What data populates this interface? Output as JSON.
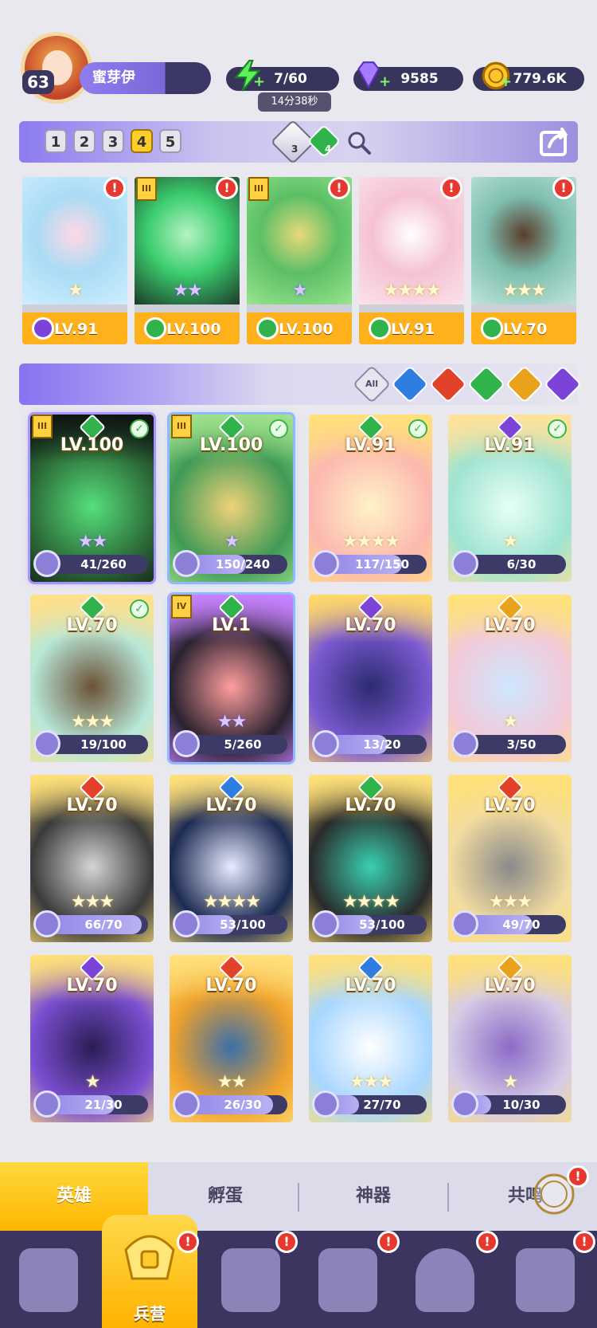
{
  "player": {
    "level": "63",
    "name": "蜜芽伊"
  },
  "resources": {
    "energy": "7/60",
    "energy_timer": "14分38秒",
    "gems": "9585",
    "gold": "779.6K"
  },
  "team_tabs": [
    "1",
    "2",
    "3",
    "4",
    "5"
  ],
  "active_team_tab": "4",
  "team_gems": {
    "purple_count": "3",
    "green_count": "4"
  },
  "team": [
    {
      "level": "LV.91",
      "element": "dark",
      "stars": "★",
      "star_color": "gold",
      "rank": "",
      "art": [
        "#cfeeff",
        "#a9dcf5",
        "#ffd8e6"
      ]
    },
    {
      "level": "LV.100",
      "element": "grass",
      "stars": "★★",
      "star_color": "purple",
      "rank": "III",
      "art": [
        "#1c3b2a",
        "#3cce6e",
        "#b6f2c5"
      ]
    },
    {
      "level": "LV.100",
      "element": "grass",
      "stars": "★",
      "star_color": "purple",
      "rank": "III",
      "art": [
        "#98e58d",
        "#5bbf66",
        "#e8d97a"
      ]
    },
    {
      "level": "LV.91",
      "element": "grass",
      "stars": "★★★★",
      "star_color": "gold",
      "rank": "",
      "art": [
        "#fbe2ea",
        "#f5c2d3",
        "#ffffff"
      ]
    },
    {
      "level": "LV.70",
      "element": "grass",
      "stars": "★★★",
      "star_color": "gold",
      "rank": "",
      "art": [
        "#bfe4d8",
        "#7fbfb0",
        "#5a3d2c"
      ]
    }
  ],
  "filters": [
    "All",
    "water",
    "fire",
    "grass",
    "light",
    "dark"
  ],
  "filter_all_label": "All",
  "heroes": [
    {
      "level": "LV.100",
      "element": "grass",
      "shards": "41/260",
      "fill": 0.16,
      "stars": "★★",
      "star_color": "purple",
      "checked": true,
      "rank": "III",
      "frame": "purple",
      "art": [
        "#101512",
        "#2d6e3a",
        "#56e07a"
      ]
    },
    {
      "level": "LV.100",
      "element": "grass",
      "shards": "150/240",
      "fill": 0.63,
      "stars": "★",
      "star_color": "purple",
      "checked": true,
      "rank": "III",
      "frame": "blue",
      "art": [
        "#9ee08c",
        "#3f9a55",
        "#f0d27a"
      ]
    },
    {
      "level": "LV.91",
      "element": "grass",
      "shards": "117/150",
      "fill": 0.78,
      "stars": "★★★★",
      "star_color": "gold",
      "checked": true,
      "rank": "",
      "frame": "",
      "art": [
        "#ffe07a",
        "#fcb8b0",
        "#fff3c6"
      ]
    },
    {
      "level": "LV.91",
      "element": "dark",
      "shards": "6/30",
      "fill": 0.2,
      "stars": "★",
      "star_color": "gold",
      "checked": true,
      "rank": "",
      "frame": "",
      "art": [
        "#ffe29a",
        "#9fe3d1",
        "#e7fff6"
      ]
    },
    {
      "level": "LV.70",
      "element": "grass",
      "shards": "19/100",
      "fill": 0.19,
      "stars": "★★★",
      "star_color": "gold",
      "checked": true,
      "rank": "",
      "frame": "",
      "art": [
        "#ffe08a",
        "#b8e8d9",
        "#6b5236"
      ]
    },
    {
      "level": "LV.1",
      "element": "grass",
      "shards": "5/260",
      "fill": 0.02,
      "stars": "★★",
      "star_color": "purple",
      "checked": false,
      "rank": "IV",
      "frame": "blue",
      "art": [
        "#c782ff",
        "#2a2230",
        "#ff9e9e"
      ]
    },
    {
      "level": "LV.70",
      "element": "dark",
      "shards": "13/20",
      "fill": 0.65,
      "stars": "",
      "star_color": "gold",
      "checked": false,
      "rank": "",
      "frame": "",
      "art": [
        "#ffd86a",
        "#7b5ad1",
        "#2c2b70"
      ]
    },
    {
      "level": "LV.70",
      "element": "light",
      "shards": "3/50",
      "fill": 0.06,
      "stars": "★",
      "star_color": "gold",
      "checked": false,
      "rank": "",
      "frame": "",
      "art": [
        "#ffe27a",
        "#f2c9d8",
        "#cfe7ff"
      ]
    },
    {
      "level": "LV.70",
      "element": "fire",
      "shards": "66/70",
      "fill": 0.94,
      "stars": "★★★",
      "star_color": "gold",
      "checked": false,
      "rank": "",
      "frame": "",
      "art": [
        "#ffe07a",
        "#3a3a3a",
        "#d5d5d5"
      ]
    },
    {
      "level": "LV.70",
      "element": "water",
      "shards": "53/100",
      "fill": 0.53,
      "stars": "★★★★",
      "star_color": "gold",
      "checked": false,
      "rank": "",
      "frame": "",
      "art": [
        "#ffe07a",
        "#1c2a52",
        "#e8ecff"
      ]
    },
    {
      "level": "LV.70",
      "element": "grass",
      "shards": "53/100",
      "fill": 0.53,
      "stars": "★★★★",
      "star_color": "gold",
      "checked": false,
      "rank": "",
      "frame": "",
      "art": [
        "#ffe07a",
        "#2a2a2a",
        "#39d1b3"
      ]
    },
    {
      "level": "LV.70",
      "element": "fire",
      "shards": "49/70",
      "fill": 0.7,
      "stars": "★★★",
      "star_color": "gold",
      "checked": false,
      "rank": "",
      "frame": "",
      "art": [
        "#ffe07a",
        "#f2dca0",
        "#8a8a8a"
      ]
    },
    {
      "level": "LV.70",
      "element": "dark",
      "shards": "21/30",
      "fill": 0.7,
      "stars": "★",
      "star_color": "gold",
      "checked": false,
      "rank": "",
      "frame": "",
      "art": [
        "#ffe07a",
        "#7b4fd1",
        "#2a1d55"
      ]
    },
    {
      "level": "LV.70",
      "element": "fire",
      "shards": "26/30",
      "fill": 0.87,
      "stars": "★★",
      "star_color": "gold",
      "checked": false,
      "rank": "",
      "frame": "",
      "art": [
        "#ffe07a",
        "#f0a22b",
        "#3b6fa8"
      ]
    },
    {
      "level": "LV.70",
      "element": "water",
      "shards": "27/70",
      "fill": 0.39,
      "stars": "★★★",
      "star_color": "gold",
      "checked": false,
      "rank": "",
      "frame": "",
      "art": [
        "#ffe07a",
        "#a7d6ff",
        "#ffffff"
      ]
    },
    {
      "level": "LV.70",
      "element": "light",
      "shards": "10/30",
      "fill": 0.33,
      "stars": "★",
      "star_color": "gold",
      "checked": false,
      "rank": "",
      "frame": "",
      "art": [
        "#ffe07a",
        "#d6cbe6",
        "#8c6bc6"
      ]
    }
  ],
  "sub_tabs": [
    "英雄",
    "孵蛋",
    "神器",
    "共鸣"
  ],
  "active_sub_tab": "英雄",
  "nav": {
    "active_label": "兵营"
  },
  "element_colors": {
    "water": "#2e7de0",
    "fire": "#e3422a",
    "grass": "#2fb34a",
    "light": "#e8a21c",
    "dark": "#7c43d8",
    "All": "#ffffff"
  }
}
